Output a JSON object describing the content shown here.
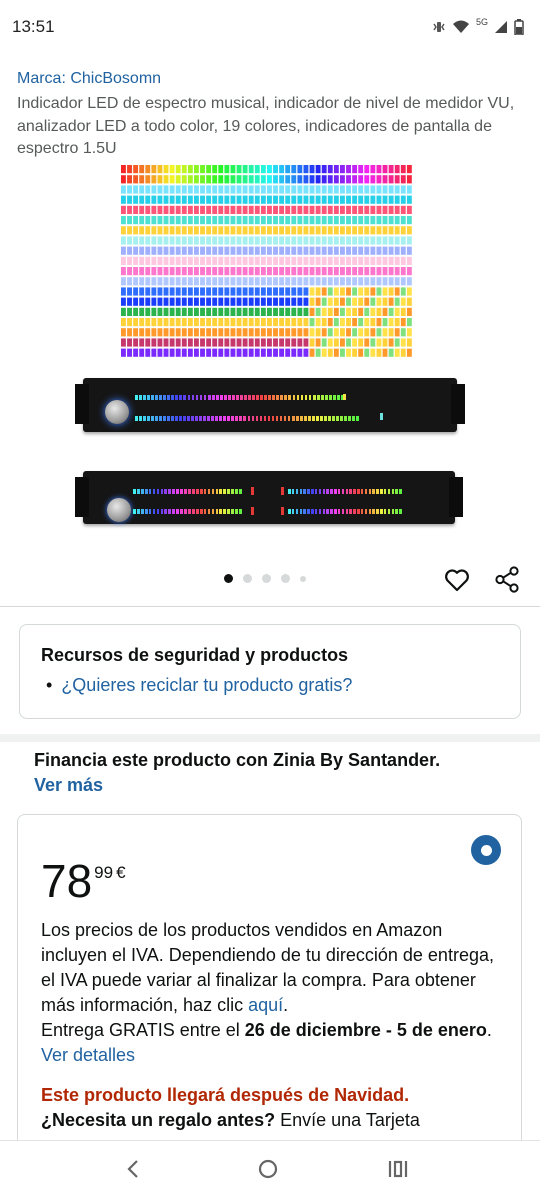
{
  "status_bar": {
    "time": "13:51",
    "network_label": "5G",
    "icons": [
      "vibrate-icon",
      "wifi-icon",
      "signal-icon",
      "battery-icon"
    ]
  },
  "product": {
    "brand": "Marca: ChicBosomn",
    "title": "Indicador LED de espectro musical, indicador de nivel de medidor VU, analizador LED a todo color, 19 colores, indicadores de pantalla de espectro 1.5U"
  },
  "gallery": {
    "image_count": 5,
    "active_index": 0,
    "icons": [
      "heart-icon",
      "share-icon"
    ]
  },
  "safety": {
    "title": "Recursos de seguridad y productos",
    "link": "¿Quieres reciclar tu producto gratis?"
  },
  "financing": {
    "text": "Financia este producto con Zinia By Santander.",
    "link": "Ver más"
  },
  "offer": {
    "price_whole": "78",
    "price_fraction": "99",
    "currency": "€",
    "vat_text": "Los precios de los productos vendidos en Amazon incluyen el IVA. Dependiendo de tu dirección de entrega, el IVA puede variar al finalizar la compra. Para obtener más información, haz clic ",
    "vat_link": "aquí",
    "vat_end": ".",
    "delivery_prefix": "Entrega GRATIS entre el ",
    "delivery_dates": "26 de diciembre - 5 de enero",
    "delivery_suffix": ". ",
    "details_link": "Ver detalles",
    "christmas_notice": "Este producto llegará después de Navidad.",
    "gift_question": "¿Necesita un regalo antes?",
    "gift_text": " Envíe una Tarjeta"
  },
  "colors": {
    "link": "#2162a1",
    "price_text": "#0f1111",
    "alert": "#b12704",
    "border": "#d5d9d9"
  },
  "nav": {
    "icons": [
      "back-icon",
      "home-icon",
      "recents-icon"
    ]
  }
}
